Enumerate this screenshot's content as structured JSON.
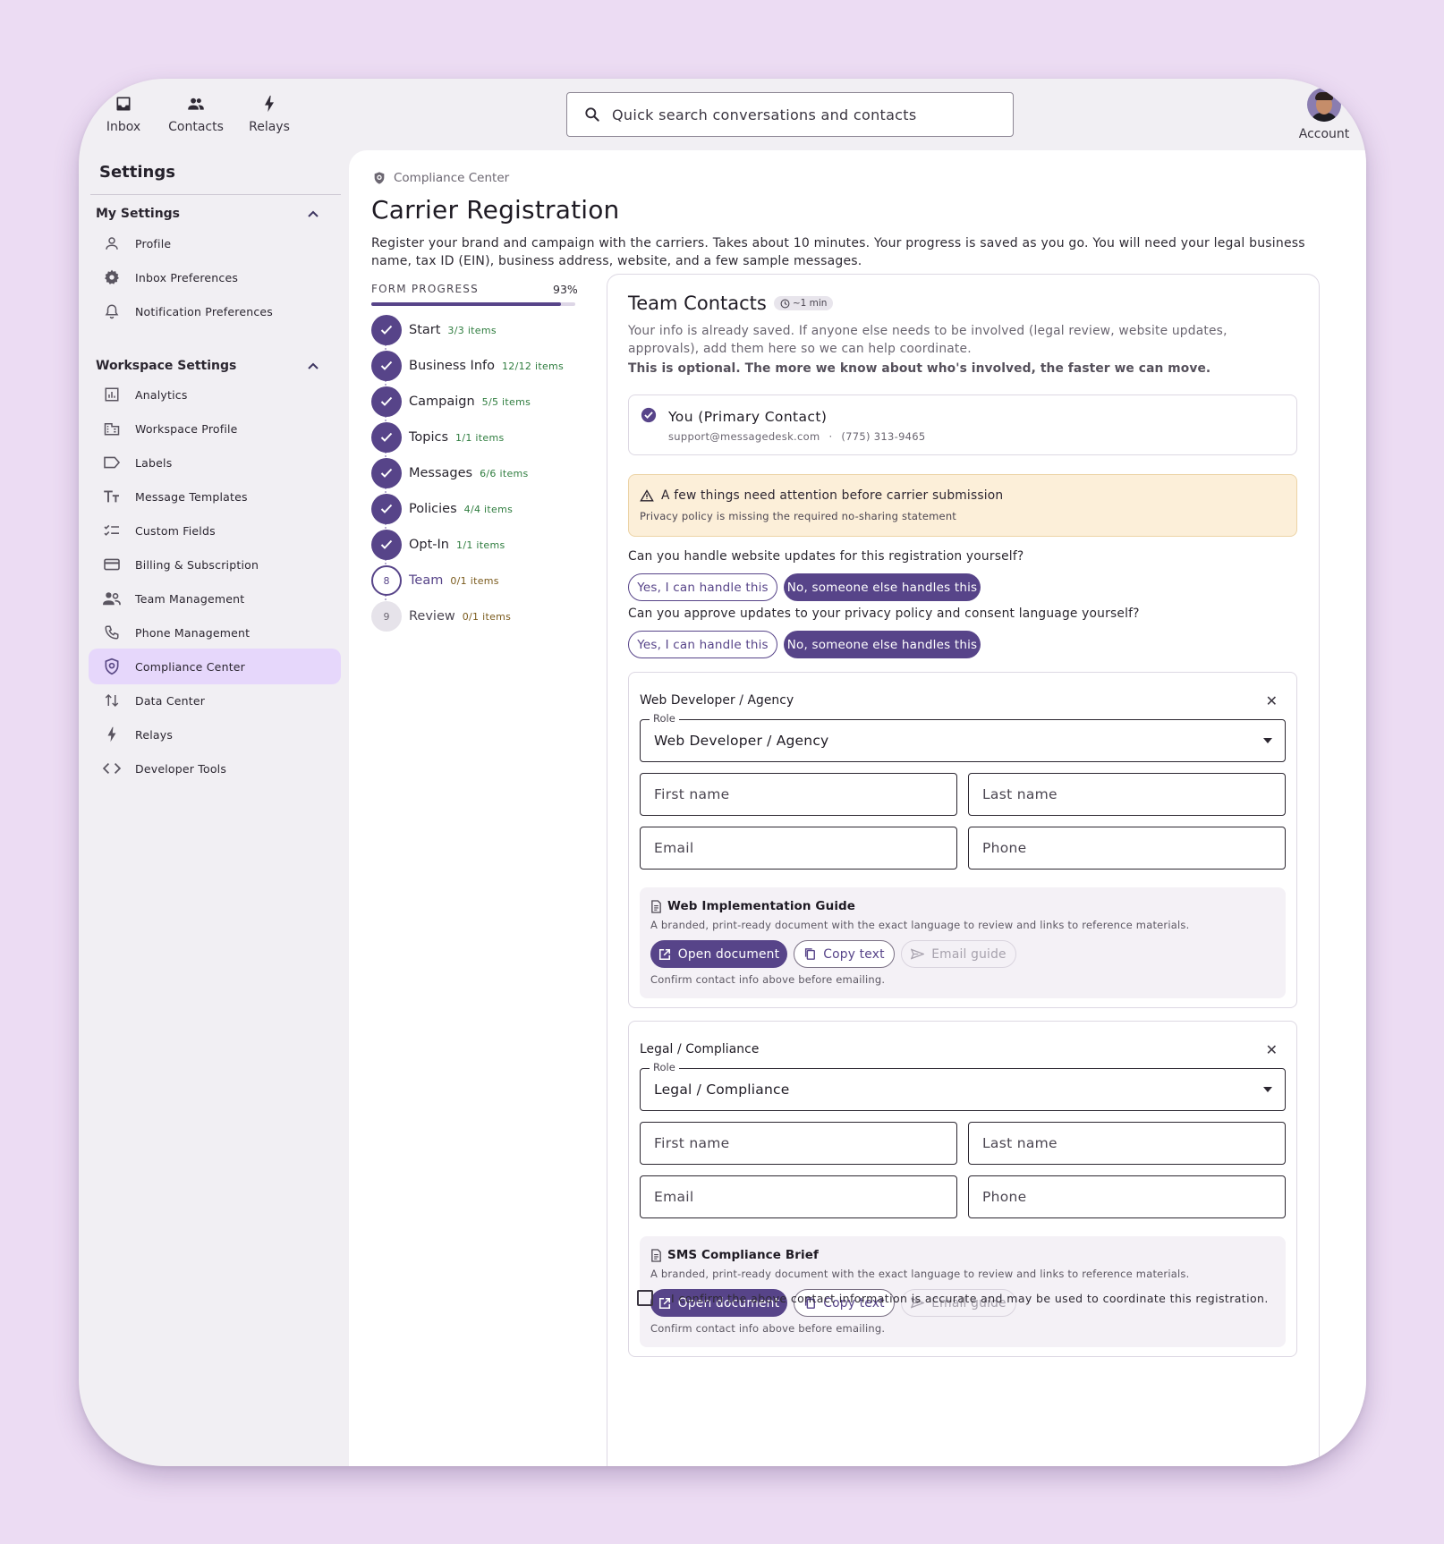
{
  "nav": {
    "items": [
      {
        "label": "Inbox",
        "icon": "inbox-icon"
      },
      {
        "label": "Contacts",
        "icon": "contacts-icon"
      },
      {
        "label": "Relays",
        "icon": "bolt-icon"
      }
    ],
    "search_placeholder": "Quick search conversations and contacts",
    "account_label": "Account"
  },
  "sidebar": {
    "title": "Settings",
    "my_settings": {
      "label": "My Settings",
      "items": [
        {
          "label": "Profile",
          "icon": "person-icon"
        },
        {
          "label": "Inbox Preferences",
          "icon": "gear-icon"
        },
        {
          "label": "Notification Preferences",
          "icon": "bell-icon"
        }
      ]
    },
    "workspace_settings": {
      "label": "Workspace Settings",
      "items": [
        {
          "label": "Analytics",
          "icon": "chart-icon"
        },
        {
          "label": "Workspace Profile",
          "icon": "building-icon"
        },
        {
          "label": "Labels",
          "icon": "label-icon"
        },
        {
          "label": "Message Templates",
          "icon": "text-icon"
        },
        {
          "label": "Custom Fields",
          "icon": "checklist-icon"
        },
        {
          "label": "Billing & Subscription",
          "icon": "card-icon"
        },
        {
          "label": "Team Management",
          "icon": "team-icon"
        },
        {
          "label": "Phone Management",
          "icon": "phone-icon"
        },
        {
          "label": "Compliance Center",
          "icon": "shield-icon",
          "active": true
        },
        {
          "label": "Data Center",
          "icon": "transfer-icon"
        },
        {
          "label": "Relays",
          "icon": "bolt-icon"
        },
        {
          "label": "Developer Tools",
          "icon": "code-icon"
        }
      ]
    }
  },
  "page": {
    "breadcrumb": "Compliance Center",
    "title": "Carrier Registration",
    "description": "Register your brand and campaign with the carriers. Takes about 10 minutes. Your progress is saved as you go. You will need your legal business name, tax ID (EIN), business address, website, and a few sample messages."
  },
  "progress": {
    "label": "FORM PROGRESS",
    "percent_text": "93%",
    "percent": 0.93,
    "steps": [
      {
        "label": "Start",
        "count": "3/3 items",
        "state": "done"
      },
      {
        "label": "Business Info",
        "count": "12/12 items",
        "state": "done"
      },
      {
        "label": "Campaign",
        "count": "5/5 items",
        "state": "done"
      },
      {
        "label": "Topics",
        "count": "1/1 items",
        "state": "done"
      },
      {
        "label": "Messages",
        "count": "6/6 items",
        "state": "done"
      },
      {
        "label": "Policies",
        "count": "4/4 items",
        "state": "done"
      },
      {
        "label": "Opt-In",
        "count": "1/1 items",
        "state": "done"
      },
      {
        "label": "Team",
        "count": "0/1 items",
        "state": "current",
        "number": "8"
      },
      {
        "label": "Review",
        "count": "0/1 items",
        "state": "todo",
        "number": "9"
      }
    ]
  },
  "team": {
    "title": "Team Contacts",
    "time": "~1 min",
    "description": "Your info is already saved. If anyone else needs to be involved (legal review, website updates, approvals), add them here so we can help coordinate.",
    "note": "This is optional. The more we know about who's involved, the faster we can move.",
    "primary": {
      "name": "You (Primary Contact)",
      "email": "support@messagedesk.com",
      "separator": "·",
      "phone": "(775) 313-9465"
    },
    "alert": {
      "title": "A few things need attention before carrier submission",
      "body": "Privacy policy is missing the required no-sharing statement"
    },
    "questions": [
      {
        "text": "Can you handle website updates for this registration yourself?",
        "yes": "Yes, I can handle this",
        "no": "No, someone else handles this"
      },
      {
        "text": "Can you approve updates to your privacy policy and consent language yourself?",
        "yes": "Yes, I can handle this",
        "no": "No, someone else handles this"
      }
    ],
    "contacts": [
      {
        "title": "Web Developer / Agency",
        "role_legend": "Role",
        "role_value": "Web Developer / Agency",
        "first_name": "First name",
        "last_name": "Last name",
        "email": "Email",
        "phone": "Phone",
        "guide": {
          "title": "Web Implementation Guide",
          "description": "A branded, print-ready document with the exact language to review and links to reference materials.",
          "open": "Open document",
          "copy": "Copy text",
          "email": "Email guide",
          "note": "Confirm contact info above before emailing."
        }
      },
      {
        "title": "Legal / Compliance",
        "role_legend": "Role",
        "role_value": "Legal / Compliance",
        "first_name": "First name",
        "last_name": "Last name",
        "email": "Email",
        "phone": "Phone",
        "guide": {
          "title": "SMS Compliance Brief",
          "description": "A branded, print-ready document with the exact language to review and links to reference materials.",
          "open": "Open document",
          "copy": "Copy text",
          "email": "Email guide",
          "note": "Confirm contact info above before emailing."
        }
      }
    ],
    "confirm": "I confirm the above contact information is accurate and may be used to coordinate this registration."
  },
  "colors": {
    "accent": "#574489",
    "active_bg": "#e6d7fb",
    "alert_bg": "#fcefd9",
    "success": "#2f7d3f"
  }
}
